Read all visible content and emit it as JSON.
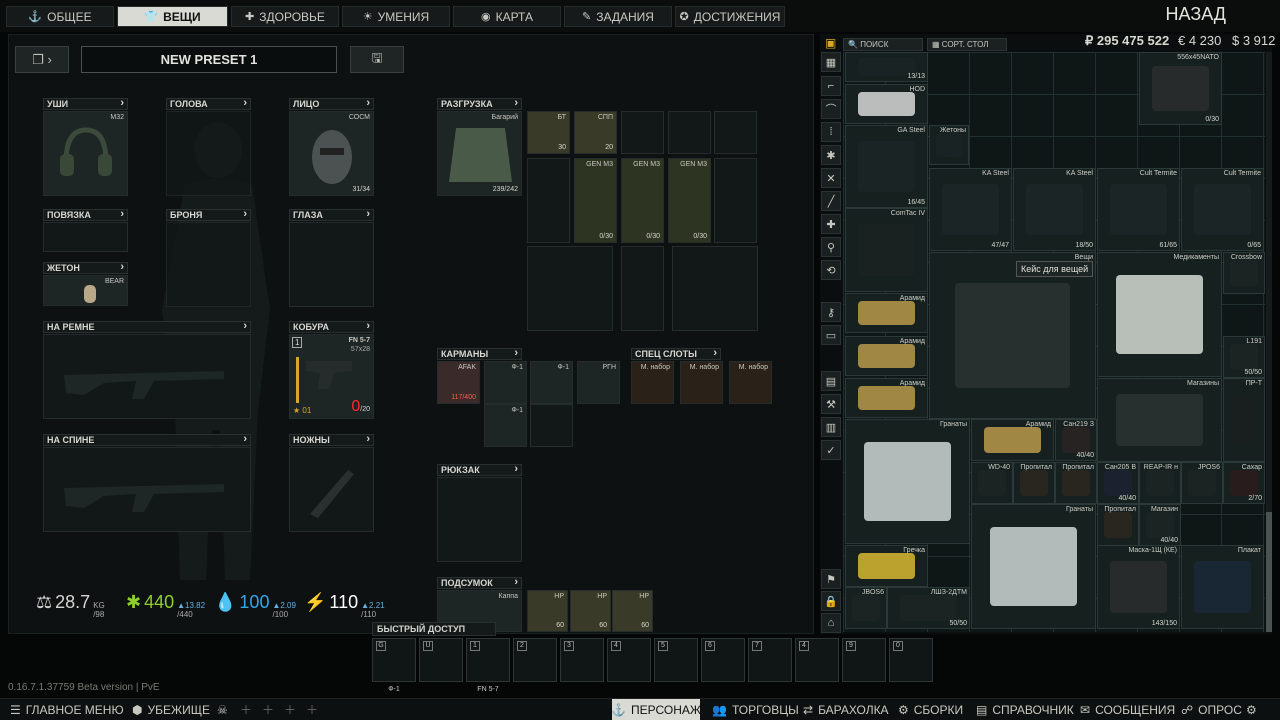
{
  "tabs": [
    {
      "label": "ОБЩЕЕ",
      "icon": "⚓"
    },
    {
      "label": "ВЕЩИ",
      "icon": "👕"
    },
    {
      "label": "ЗДОРОВЬЕ",
      "icon": "✚"
    },
    {
      "label": "УМЕНИЯ",
      "icon": "☀"
    },
    {
      "label": "КАРТА",
      "icon": "◉"
    },
    {
      "label": "ЗАДАНИЯ",
      "icon": "✎"
    },
    {
      "label": "ДОСТИЖЕНИЯ",
      "icon": "✪"
    }
  ],
  "back_label": "НАЗАД",
  "preset": {
    "name": "NEW PRESET 1"
  },
  "slots": {
    "ears": {
      "label": "УШИ",
      "item": "M32"
    },
    "head": {
      "label": "ГОЛОВА"
    },
    "face": {
      "label": "ЛИЦО",
      "item": "СОСМ",
      "count": "31/34"
    },
    "armband": {
      "label": "ПОВЯЗКА"
    },
    "armor": {
      "label": "БРОНЯ"
    },
    "eyes": {
      "label": "ГЛАЗА"
    },
    "dogtag": {
      "label": "ЖЕТОН",
      "item": "BEAR"
    },
    "sling": {
      "label": "НА РЕМНЕ"
    },
    "holster": {
      "label": "КОБУРА",
      "item": "FN 5-7",
      "ammo_type": "57x28",
      "key": "1",
      "count_low": "0",
      "count_max": "/20",
      "level": "01"
    },
    "back": {
      "label": "НА СПИНЕ"
    },
    "scabbard": {
      "label": "НОЖНЫ"
    },
    "rig": {
      "label": "РАЗГРУЗКА",
      "item": "Багарий",
      "count": "239/242"
    },
    "pockets": {
      "label": "КАРМАНЫ"
    },
    "special": {
      "label": "СПЕЦ СЛОТЫ"
    },
    "backpack": {
      "label": "РЮКЗАК"
    },
    "pouch": {
      "label": "ПОДСУМОК",
      "item": "Каппа"
    }
  },
  "rig_items": [
    {
      "name": "БТ",
      "count": "30"
    },
    {
      "name": "СПП",
      "count": "20"
    },
    {
      "name": "GEN M3",
      "count": "0/30"
    },
    {
      "name": "GEN M3",
      "count": "0/30"
    },
    {
      "name": "GEN M3",
      "count": "0/30"
    }
  ],
  "pocket_items": [
    {
      "name": "AFAK",
      "count": "117/400"
    },
    {
      "name": "Ф-1"
    },
    {
      "name": "Ф-1"
    },
    {
      "name": "РГН"
    },
    {
      "name": "Ф-1"
    }
  ],
  "special_items": [
    {
      "name": "М. набор"
    },
    {
      "name": "М. набор"
    },
    {
      "name": "М. набор"
    }
  ],
  "pouch_items": [
    {
      "name": "НР",
      "count": "60"
    },
    {
      "name": "НР",
      "count": "60"
    },
    {
      "name": "НР",
      "count": "60"
    }
  ],
  "stats": {
    "weight": "28.7",
    "weight_unit": "KG",
    "weight_max": "/98",
    "health": "440",
    "health_regen": "▲13.82",
    "health_max": "/440",
    "hydration": "100",
    "hydration_regen": "▲2.09",
    "hydration_max": "/100",
    "energy": "110",
    "energy_regen": "▲2.21",
    "energy_max": "/110"
  },
  "quick_access": {
    "label": "БЫСТРЫЙ ДОСТУП",
    "slots": [
      {
        "key": "G",
        "item": "Ф-1"
      },
      {
        "key": "U",
        "item": ""
      },
      {
        "key": "1",
        "item": "FN 5-7"
      },
      {
        "key": "2",
        "item": ""
      },
      {
        "key": "3",
        "item": ""
      },
      {
        "key": "4",
        "item": ""
      },
      {
        "key": "5",
        "item": ""
      },
      {
        "key": "6",
        "item": ""
      },
      {
        "key": "7",
        "item": ""
      },
      {
        "key": "4",
        "item": ""
      },
      {
        "key": "9",
        "item": ""
      },
      {
        "key": "0",
        "item": ""
      }
    ]
  },
  "version": "0.16.7.1.37759 Beta version | PvE",
  "stash": {
    "search": "ПОИСК",
    "sort": "СОРТ. СТОЛ",
    "currency": {
      "rub": "₽ 295 475 522",
      "eur": "€ 4 230",
      "usd": "$ 3 912"
    },
    "tooltip": "Кейс для вещей",
    "items": [
      {
        "name": "",
        "count": "13/13"
      },
      {
        "name": "HOD",
        "count": ""
      },
      {
        "name": "GA Steel",
        "count": "16/45"
      },
      {
        "name": "Жетоны",
        "count": ""
      },
      {
        "name": "556x45NATO",
        "count": "0/30"
      },
      {
        "name": "KA Steel",
        "count": "47/47"
      },
      {
        "name": "KA Steel",
        "count": "18/50"
      },
      {
        "name": "Cult Termite",
        "count": "61/65"
      },
      {
        "name": "Cult Termite",
        "count": "0/65"
      },
      {
        "name": "ComTac IV",
        "count": ""
      },
      {
        "name": "Вещи",
        "count": ""
      },
      {
        "name": "Медикаменты",
        "count": ""
      },
      {
        "name": "Crossbow",
        "count": ""
      },
      {
        "name": "Арамид",
        "count": ""
      },
      {
        "name": "Арамид",
        "count": ""
      },
      {
        "name": "Арамид",
        "count": ""
      },
      {
        "name": "L191",
        "count": "50/50"
      },
      {
        "name": "Магазины",
        "count": ""
      },
      {
        "name": "ПР-Т",
        "count": ""
      },
      {
        "name": "Гранаты",
        "count": ""
      },
      {
        "name": "Арамид",
        "count": ""
      },
      {
        "name": "Сан219 З",
        "count": "40/40"
      },
      {
        "name": "WD-40",
        "count": ""
      },
      {
        "name": "Пропитал",
        "count": ""
      },
      {
        "name": "Пропитал",
        "count": ""
      },
      {
        "name": "Сан205 В",
        "count": "40/40"
      },
      {
        "name": "REAP-IR н",
        "count": ""
      },
      {
        "name": "JPOS6",
        "count": ""
      },
      {
        "name": "Сахар",
        "count": "2/70"
      },
      {
        "name": "Гранаты",
        "count": ""
      },
      {
        "name": "Пропитал",
        "count": ""
      },
      {
        "name": "Магазин",
        "count": "40/40"
      },
      {
        "name": "Гречка",
        "count": ""
      },
      {
        "name": "Маска-1Щ (КЕ)",
        "count": "143/150"
      },
      {
        "name": "Плакат",
        "count": ""
      },
      {
        "name": "JBOS6",
        "count": ""
      },
      {
        "name": "ЛШЗ-2ДТМ",
        "count": "50/50"
      }
    ]
  },
  "bottom": {
    "menu": "ГЛАВНОЕ МЕНЮ",
    "hideout": "УБЕЖИЩЕ",
    "character": "ПЕРСОНАЖ",
    "traders": "ТОРГОВЦЫ",
    "flea": "БАРАХОЛКА",
    "builds": "СБОРКИ",
    "handbook": "СПРАВОЧНИК",
    "messages": "СООБЩЕНИЯ",
    "survey": "ОПРОС"
  },
  "colors": {
    "accent": "#d9dad4",
    "danger": "#ff2a2a",
    "health": "#8fcf2a",
    "hydration": "#36a4e8",
    "energy": "#ffffff",
    "gold": "#d8a62a"
  }
}
